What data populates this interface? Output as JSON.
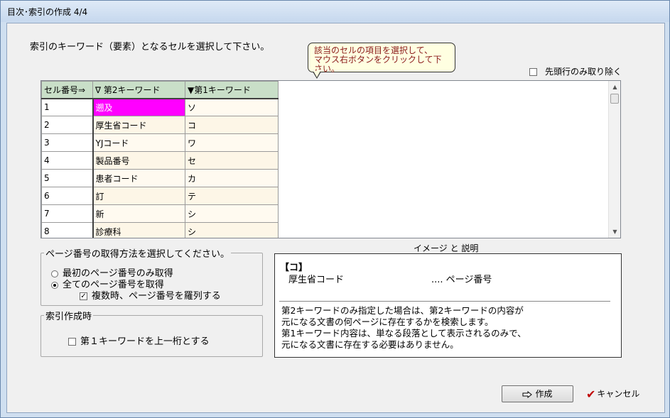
{
  "window": {
    "title": "目次･索引の作成 4/4"
  },
  "instruction": "索引のキーワード（要素）となるセルを選択して下さい。",
  "callout": {
    "line1": "該当のセルの項目を選択して、",
    "line2": "マウス右ボタンをクリックして下さい。"
  },
  "first_row_option": {
    "label": "先頭行のみ取り除く",
    "checked": false
  },
  "grid": {
    "headers": [
      "セル番号⇒",
      "∇ 第2キーワード",
      "▼第1キーワード"
    ],
    "rows": [
      {
        "num": "1",
        "k2": "遡及",
        "k1": "ソ",
        "selected": true
      },
      {
        "num": "2",
        "k2": "厚生省コード",
        "k1": "コ"
      },
      {
        "num": "3",
        "k2": "YJコード",
        "k1": "ワ"
      },
      {
        "num": "4",
        "k2": "製品番号",
        "k1": "セ"
      },
      {
        "num": "5",
        "k2": "患者コード",
        "k1": "カ"
      },
      {
        "num": "6",
        "k2": "訂",
        "k1": "テ"
      },
      {
        "num": "7",
        "k2": "新",
        "k1": "シ"
      },
      {
        "num": "8",
        "k2": "診療科",
        "k1": "シ"
      }
    ]
  },
  "page_group": {
    "legend": "ページ番号の取得方法を選択してください。",
    "option_first": "最初のページ番号のみ取得",
    "option_all": "全てのページ番号を取得",
    "option_list": "複数時、ページ番号を羅列する",
    "selected": "all",
    "list_checked": true
  },
  "index_group": {
    "legend": "索引作成時",
    "option_upper": "第１キーワードを上一桁とする",
    "upper_checked": false
  },
  "preview": {
    "label": "イメージ と 説明",
    "head": "【コ】",
    "keyword": "厚生省コード",
    "page": ".... ページ番号",
    "desc1": "第2キーワードのみ指定した場合は、第2キーワードの内容が",
    "desc2": "元になる文書の何ページに存在するかを検索します。",
    "desc3": "第1キーワード内容は、単なる段落として表示されるのみで、",
    "desc4": "元になる文書に存在する必要はありません。"
  },
  "buttons": {
    "create": "作成",
    "cancel": "キャンセル"
  },
  "colors": {
    "selected_cell": "#ff00ff",
    "header_bg": "#c9dfc8",
    "callout_text": "#8b1a1a"
  }
}
